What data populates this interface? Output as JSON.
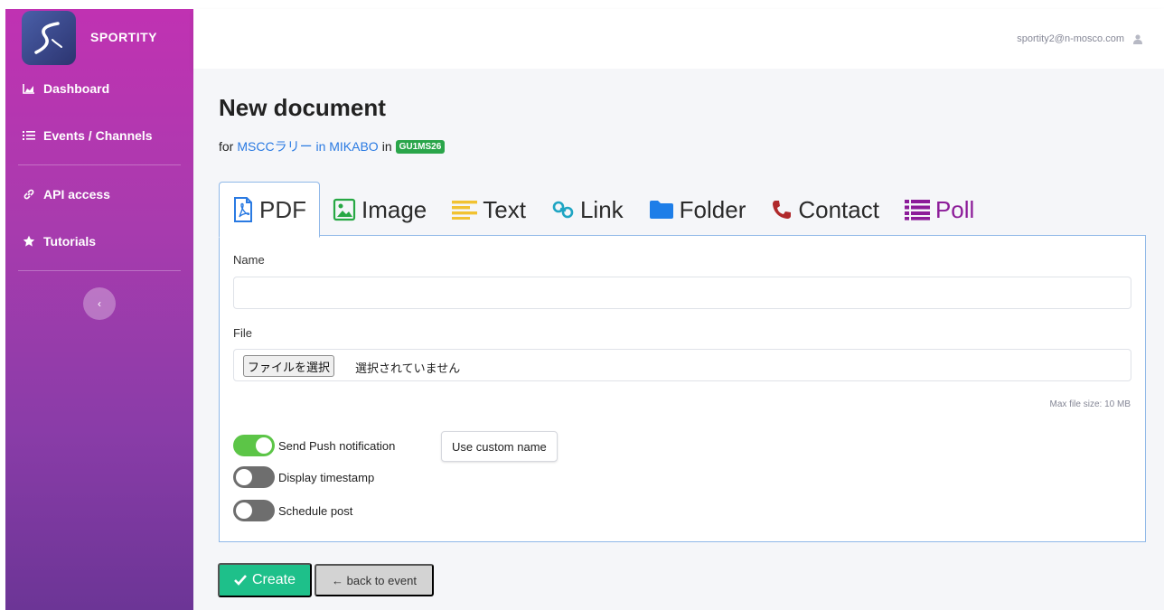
{
  "sidebar": {
    "brand": "SPORTITY",
    "items": [
      {
        "label": "Dashboard",
        "icon": "chart-area-icon"
      },
      {
        "label": "Events / Channels",
        "icon": "list-icon"
      },
      {
        "label": "API access",
        "icon": "link-icon"
      },
      {
        "label": "Tutorials",
        "icon": "star-icon"
      }
    ],
    "collapse_label": "‹"
  },
  "topbar": {
    "user_email": "sportity2@n-mosco.com",
    "user_icon": "user-icon"
  },
  "page": {
    "title": "New document",
    "subtitle_prefix": "for",
    "event_link": "MSCCラリー in MIKABO",
    "in_word": "in",
    "code_badge": "GU1MS26"
  },
  "tabs": [
    {
      "label": "PDF",
      "icon": "file-pdf-icon",
      "active": true
    },
    {
      "label": "Image",
      "icon": "image-icon"
    },
    {
      "label": "Text",
      "icon": "align-left-icon"
    },
    {
      "label": "Link",
      "icon": "link-icon"
    },
    {
      "label": "Folder",
      "icon": "folder-icon"
    },
    {
      "label": "Contact",
      "icon": "phone-icon"
    },
    {
      "label": "Poll",
      "icon": "poll-list-icon"
    }
  ],
  "form": {
    "name_label": "Name",
    "name_value": "",
    "file_label": "File",
    "file_button": "ファイルを選択",
    "file_status": "選択されていません",
    "max_file_size": "Max file size: 10 MB",
    "toggles": [
      {
        "label": "Send Push notification",
        "on": true
      },
      {
        "label": "Display timestamp",
        "on": false
      },
      {
        "label": "Schedule post",
        "on": false
      }
    ],
    "custom_name_button": "Use custom name"
  },
  "actions": {
    "create": "Create",
    "back": "← back to event"
  },
  "colors": {
    "sidebar_top": "#c032b2",
    "sidebar_bottom": "#6c3596",
    "create_green": "#1ec08a",
    "toggle_on": "#5cc547",
    "link_blue": "#2a7ae2",
    "badge_green": "#2aa54a",
    "poll_purple": "#8c1c99"
  }
}
